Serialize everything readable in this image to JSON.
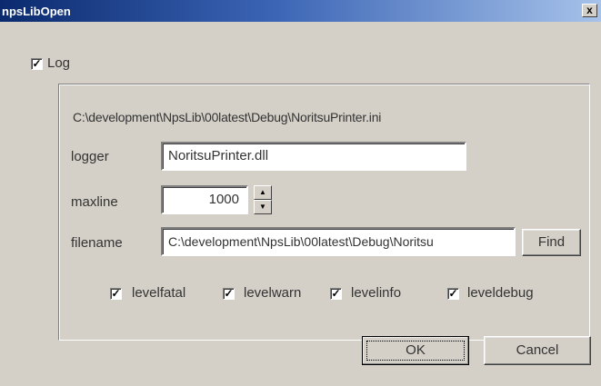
{
  "window": {
    "title": "npsLibOpen",
    "close_glyph": "x"
  },
  "log": {
    "label": "Log",
    "checked": true
  },
  "group": {
    "ini_path": "C:\\development\\NpsLib\\00latest\\Debug\\NoritsuPrinter.ini",
    "logger_label": "logger",
    "logger_value": "NoritsuPrinter.dll",
    "maxline_label": "maxline",
    "maxline_value": "1000",
    "filename_label": "filename",
    "filename_value": "C:\\development\\NpsLib\\00latest\\Debug\\Noritsu",
    "find_label": "Find",
    "levels": [
      {
        "label": "levelfatal",
        "checked": true
      },
      {
        "label": "levelwarn",
        "checked": true
      },
      {
        "label": "levelinfo",
        "checked": true
      },
      {
        "label": "leveldebug",
        "checked": true
      }
    ]
  },
  "buttons": {
    "ok": "OK",
    "cancel": "Cancel"
  },
  "icons": {
    "check": "check-icon",
    "spin_up": "up-arrow-icon",
    "spin_down": "down-arrow-icon",
    "close": "close-icon"
  },
  "colors": {
    "titlebar_start": "#0b2a6e",
    "titlebar_end": "#a6c2ea",
    "face": "#d4d0c8"
  }
}
